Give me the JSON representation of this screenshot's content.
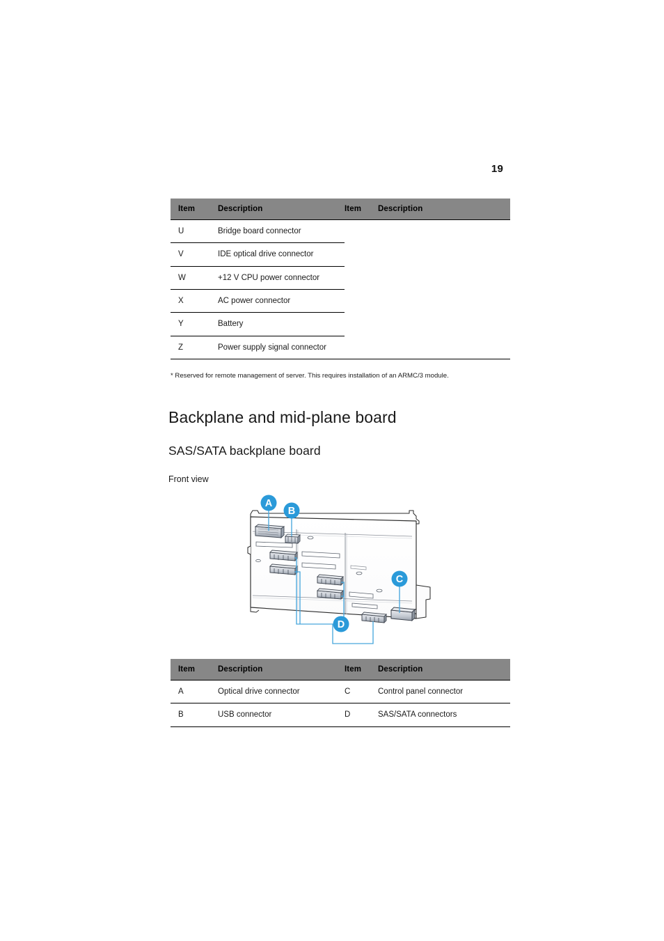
{
  "page": {
    "number": "19"
  },
  "table_top": {
    "name": "mainboard-connector-table",
    "headers": [
      "Item",
      "Description",
      "Item",
      "Description"
    ],
    "rows": [
      {
        "item": "U",
        "description": "Bridge board connector",
        "item2": "",
        "description2": ""
      },
      {
        "item": "V",
        "description": "IDE optical drive connector",
        "item2": "",
        "description2": ""
      },
      {
        "item": "W",
        "description": "+12 V CPU power connector",
        "item2": "",
        "description2": ""
      },
      {
        "item": "X",
        "description": "AC power connector",
        "item2": "",
        "description2": ""
      },
      {
        "item": "Y",
        "description": "Battery",
        "item2": "",
        "description2": ""
      },
      {
        "item": "Z",
        "description": "Power supply signal connector",
        "item2": "",
        "description2": ""
      }
    ]
  },
  "footnote": {
    "text": "* Reserved for remote management of server. This requires installation of an ARMC/3 module."
  },
  "headings": {
    "h1": "Backplane and mid-plane board",
    "h2": "SAS/SATA backplane board",
    "caption": "Front view"
  },
  "figure": {
    "name": "sas-sata-backplane-front-view",
    "callouts": [
      {
        "label": "A",
        "target": "Optical drive connector"
      },
      {
        "label": "B",
        "target": "USB connector"
      },
      {
        "label": "C",
        "target": "Control panel connector"
      },
      {
        "label": "D",
        "target": "SAS/SATA connectors"
      }
    ],
    "colors": {
      "callout_blue": "#2B9AD9",
      "leader_blue": "#49A7DC",
      "board_outline": "#2b2b2b",
      "connector_fill": "#c9cdd4",
      "connector_dark": "#5c6470"
    }
  },
  "table_bottom": {
    "name": "backplane-callout-table",
    "headers": [
      "Item",
      "Description",
      "Item",
      "Description"
    ],
    "rows": [
      {
        "item": "A",
        "description": "Optical drive connector",
        "item2": "C",
        "description2": "Control panel connector"
      },
      {
        "item": "B",
        "description": "USB connector",
        "item2": "D",
        "description2": "SAS/SATA connectors"
      }
    ]
  }
}
